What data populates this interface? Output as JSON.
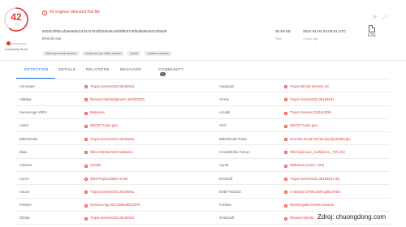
{
  "score": {
    "detected": "42",
    "total": "/ 70",
    "color": "#e53935",
    "community_label": "Community Score"
  },
  "alert": {
    "icon": "exclamation-circle-icon",
    "text": "42 engines detected this file"
  },
  "file": {
    "hash": "8203c2f00ecd3ae9d5cb3247a7d1bfb33e65c28f3f9b07c8fbdb6b5c9214f93d9",
    "name": "BAIKJK.exe",
    "tags": [
      "direct-cpu-clock-access",
      "invalid-rich-pe-linker-version",
      "peexe",
      "runtime-modules"
    ]
  },
  "meta": {
    "size_value": "30.50 KB",
    "size_label": "Size",
    "date_value": "2021-01-04 03:00:51 UTC",
    "date_label": "1 hour ago",
    "file_type": "EXE"
  },
  "tabs": [
    {
      "label": "DETECTION",
      "active": true
    },
    {
      "label": "DETAILS",
      "active": false
    },
    {
      "label": "RELATIONS",
      "active": false
    },
    {
      "label": "BEHAVIOR",
      "active": false
    },
    {
      "label": "COMMUNITY",
      "active": false,
      "badge": "1"
    }
  ],
  "detections": [
    [
      {
        "engine": "Ad-Aware",
        "result": "Trojan.GenericKD.36164841"
      },
      {
        "engine": "AegisLab",
        "result": "Trojan.Win32.Generic.4!c"
      }
    ],
    [
      {
        "engine": "Alibaba",
        "result": "Ransom:Win32/generic.ali2000010"
      },
      {
        "engine": "ALYac",
        "result": "Trojan.GenericKD.36164841"
      }
    ],
    [
      {
        "engine": "SecureAge APEX",
        "result": "Malicious"
      },
      {
        "engine": "Arcabit",
        "result": "Trojan.Generic.D224A3D8"
      }
    ],
    [
      {
        "engine": "Avast",
        "result": "Win32:Trojan-gen"
      },
      {
        "engine": "AVG",
        "result": "Win32:Trojan-gen"
      }
    ],
    [
      {
        "engine": "BitDefender",
        "result": "Trojan.GenericKD.36164841"
      },
      {
        "engine": "BitDefenderTheta",
        "result": "Gen:NN.ZexaF.34700.bq1@aK6dRdgo"
      }
    ],
    [
      {
        "engine": "Bkav",
        "result": "W32.AIDetectVM.malware1"
      },
      {
        "engine": "CrowdStrike Falcon",
        "result": "Win/malicious_confidence_70% (D)"
      }
    ],
    [
      {
        "engine": "Cylance",
        "result": "Unsafe"
      },
      {
        "engine": "Cynet",
        "result": "Malicious (score: 100)"
      }
    ],
    [
      {
        "engine": "Cyren",
        "result": "W32/Trojan.DBDH-6762"
      },
      {
        "engine": "Emsisoft",
        "result": "Trojan.GenericKD.36164841 (B)"
      }
    ],
    [
      {
        "engine": "eScan",
        "result": "Trojan.GenericKD.36164841"
      },
      {
        "engine": "ESET-NOD32",
        "result": "A Variant Of Win32/Kryptik.HHIG"
      }
    ],
    [
      {
        "engine": "FireEye",
        "result": "Generic.mg.e1571bb4e5b37b70"
      },
      {
        "engine": "Fortinet",
        "result": "W32/Kryptik.HHIG!tr.ransom"
      }
    ],
    [
      {
        "engine": "GData",
        "result": "Trojan.GenericKD.36164841"
      },
      {
        "engine": "Gridinsoft",
        "result": "Ransom.Win32.DefRay.oa"
      }
    ]
  ],
  "watermark": "Zdroj: chuongdong.com"
}
